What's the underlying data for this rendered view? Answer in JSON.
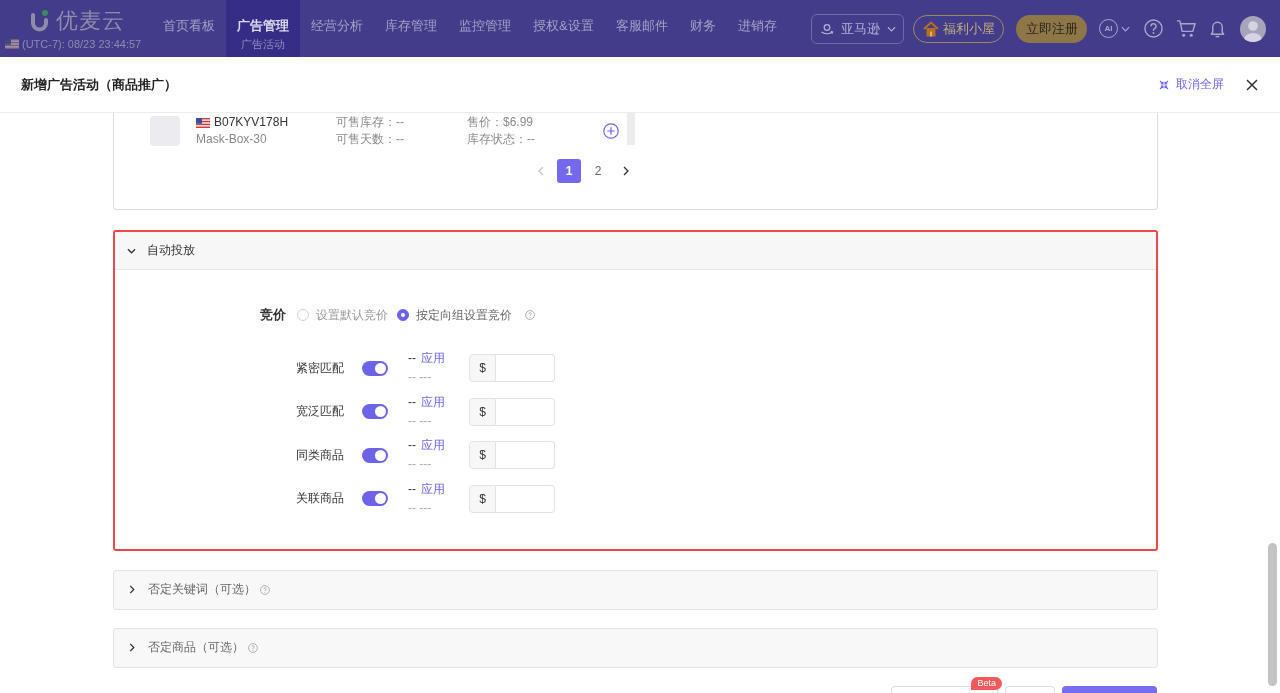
{
  "top_nav": {
    "logo": "优麦云",
    "clock": "(UTC-7): 08/23 23:44:57",
    "menu": [
      {
        "label": "首页看板",
        "selected": false
      },
      {
        "label": "广告管理",
        "sublabel": "广告活动",
        "selected": true
      },
      {
        "label": "经营分析",
        "selected": false
      },
      {
        "label": "库存管理",
        "selected": false
      },
      {
        "label": "监控管理",
        "selected": false
      },
      {
        "label": "授权&设置",
        "selected": false
      },
      {
        "label": "客服邮件",
        "selected": false
      },
      {
        "label": "财务",
        "selected": false
      },
      {
        "label": "进销存",
        "selected": false
      }
    ],
    "marketplace": "亚马逊",
    "welfare_button": "福利小屋",
    "register_button": "立即注册",
    "ai_button": "AI"
  },
  "modal": {
    "title": "新增广告活动（商品推广）",
    "exit_fullscreen": "取消全屏"
  },
  "product_list": {
    "products": [
      {
        "asin": "B07KYV178H",
        "sku": "Mask-Box-30",
        "stats": [
          "可售库存：--",
          "售价：$6.99",
          "可售天数：--",
          "库存状态：--"
        ]
      }
    ],
    "pagination": {
      "prev_disabled": true,
      "next_disabled": false,
      "pages": [
        {
          "label": "1",
          "selected": true
        },
        {
          "label": "2",
          "selected": false
        }
      ]
    }
  },
  "auto_targeting": {
    "title": "自动投放",
    "expanded": true,
    "highlighted": true,
    "bid_label": "竞价",
    "bid_options": [
      {
        "label": "设置默认竞价",
        "selected": false,
        "help": false
      },
      {
        "label": "按定向组设置竞价",
        "selected": true,
        "help": true
      }
    ],
    "groups": [
      {
        "name": "紧密匹配",
        "on": true,
        "suggested": "--",
        "apply": "应用",
        "range": "-- ---",
        "currency": "$"
      },
      {
        "name": "宽泛匹配",
        "on": true,
        "suggested": "--",
        "apply": "应用",
        "range": "-- ---",
        "currency": "$"
      },
      {
        "name": "同类商品",
        "on": true,
        "suggested": "--",
        "apply": "应用",
        "range": "-- ---",
        "currency": "$"
      },
      {
        "name": "关联商品",
        "on": true,
        "suggested": "--",
        "apply": "应用",
        "range": "-- ---",
        "currency": "$"
      }
    ]
  },
  "optional_sections": [
    {
      "title": "否定关键词（可选）",
      "expanded": false,
      "help": true
    },
    {
      "title": "否定商品（可选）",
      "expanded": false,
      "help": true
    }
  ],
  "footer": {
    "buttons": [
      {
        "kind": "outline",
        "badge": "Beta"
      },
      {
        "kind": "outline"
      },
      {
        "kind": "primary"
      }
    ]
  }
}
